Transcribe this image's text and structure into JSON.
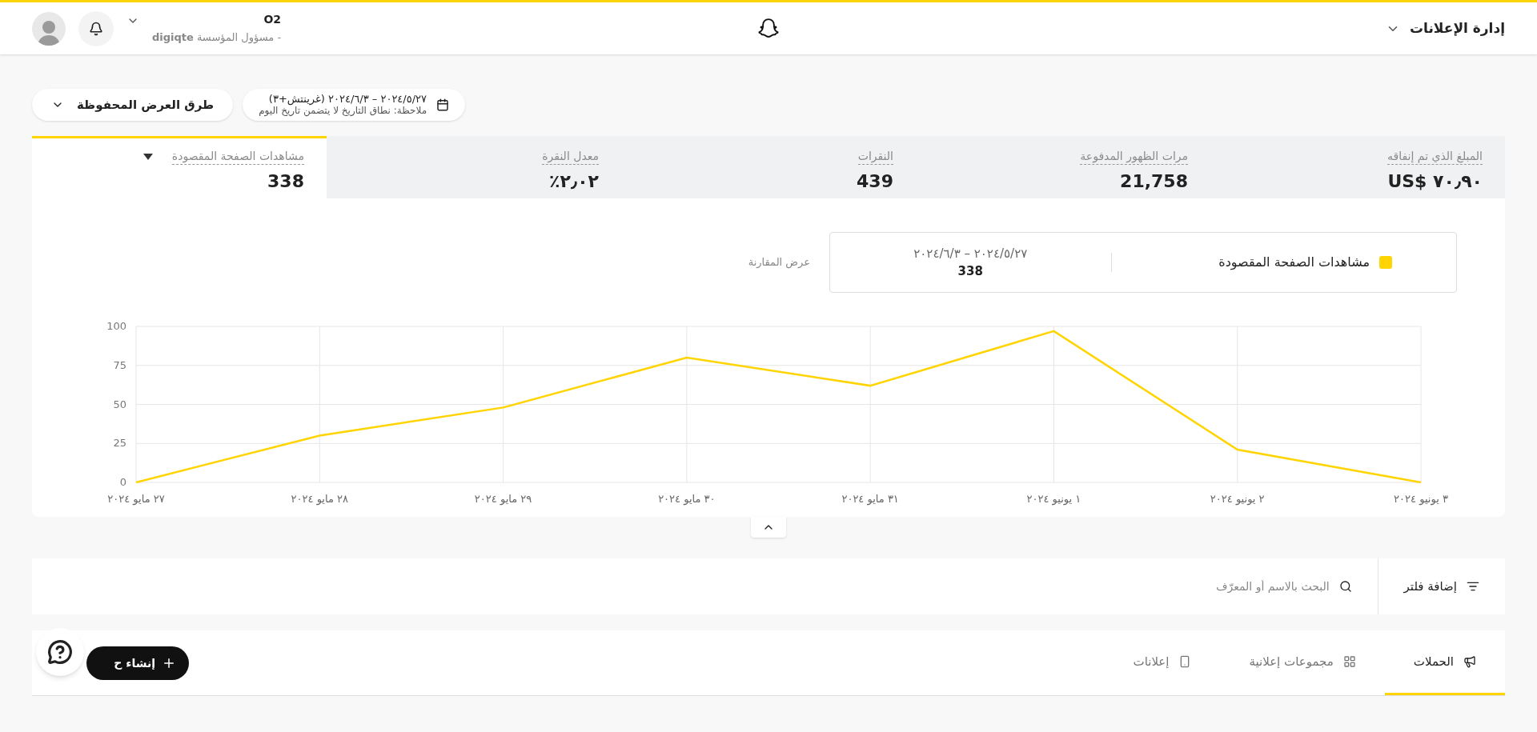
{
  "header": {
    "title": "إدارة الإعلانات",
    "account": {
      "name": "O2",
      "org": "digiqte",
      "role": "- مسؤول المؤسسة"
    }
  },
  "toolbar": {
    "date_range": "٢٠٢٤/٥/٢٧ – ٢٠٢٤/٦/٣ (غرينتش+٣)",
    "date_note": "ملاحظة: نطاق التاريخ لا يتضمن تاريخ اليوم",
    "saved_views": "طرق العرض المحفوظة"
  },
  "metrics": [
    {
      "label": "المبلغ الذي تم إنفاقه",
      "value": "٧٠٫٩٠ $US",
      "selected": false
    },
    {
      "label": "مرات الظهور المدفوعة",
      "value": "21,758",
      "selected": false
    },
    {
      "label": "النقرات",
      "value": "439",
      "selected": false
    },
    {
      "label": "معدل النقرة",
      "value": "٢٫٠٢٪",
      "selected": false
    },
    {
      "label": "مشاهدات الصفحة المقصودة",
      "value": "338",
      "selected": true
    }
  ],
  "legend": {
    "range": "٢٠٢٤/٥/٢٧ – ٢٠٢٤/٦/٣",
    "total": "338",
    "compare": "عرض المقارنة"
  },
  "chart_data": {
    "type": "line",
    "grid": true,
    "categories": [
      "٢٧ مايو ٢٠٢٤",
      "٢٨ مايو ٢٠٢٤",
      "٢٩ مايو ٢٠٢٤",
      "٣٠ مايو ٢٠٢٤",
      "٣١ مايو ٢٠٢٤",
      "١ يونيو ٢٠٢٤",
      "٢ يونيو ٢٠٢٤",
      "٣ يونيو ٢٠٢٤"
    ],
    "ylim": [
      0,
      100
    ],
    "yticks": [
      0,
      25,
      50,
      75,
      100
    ],
    "series": [
      {
        "name": "مشاهدات الصفحة المقصودة",
        "color": "#ffd400",
        "values": [
          0,
          30,
          48,
          80,
          62,
          97,
          21,
          0
        ]
      }
    ]
  },
  "filter_bar": {
    "add_filter": "إضافة فلتر",
    "search_placeholder": "البحث بالاسم أو المعرّف"
  },
  "tabs": [
    {
      "label": "الحملات",
      "kind": "campaigns",
      "selected": true
    },
    {
      "label": "مجموعات إعلانية",
      "kind": "adsets",
      "selected": false
    },
    {
      "label": "إعلانات",
      "kind": "ads",
      "selected": false
    }
  ],
  "create_button": "إنشاء ح"
}
